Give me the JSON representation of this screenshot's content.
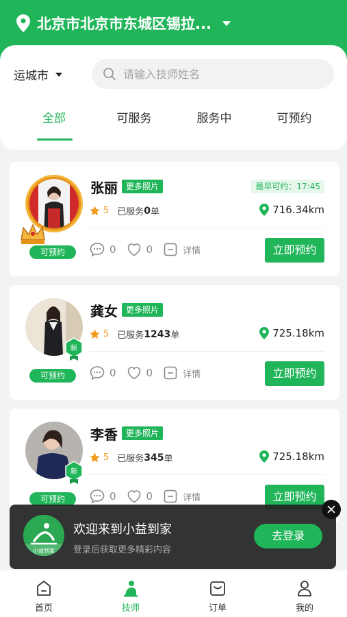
{
  "header": {
    "location": "北京市北京市东城区锡拉..."
  },
  "filter": {
    "city": "运城市",
    "search_placeholder": "请输入技师姓名"
  },
  "tabs": [
    {
      "label": "全部",
      "active": true
    },
    {
      "label": "可服务",
      "active": false
    },
    {
      "label": "服务中",
      "active": false
    },
    {
      "label": "可预约",
      "active": false
    }
  ],
  "technicians": [
    {
      "name": "张丽",
      "more_photos": "更多照片",
      "earliest": "最早可约：17:45",
      "rating": "5",
      "served_prefix": "已服务",
      "served_count": "0",
      "served_suffix": "单",
      "distance": "716.34km",
      "comments": "0",
      "likes": "0",
      "details": "详情",
      "book": "立即预约",
      "status": "可预约"
    },
    {
      "name": "龚女",
      "more_photos": "更多照片",
      "rating": "5",
      "served_prefix": "已服务",
      "served_count": "1243",
      "served_suffix": "单",
      "distance": "725.18km",
      "comments": "0",
      "likes": "0",
      "details": "详情",
      "book": "立即预约",
      "status": "可预约",
      "badge": "新"
    },
    {
      "name": "李香",
      "more_photos": "更多照片",
      "rating": "5",
      "served_prefix": "已服务",
      "served_count": "345",
      "served_suffix": "单",
      "distance": "725.18km",
      "comments": "0",
      "likes": "0",
      "details": "详情",
      "book": "立即预约",
      "status": "可预约",
      "badge": "新"
    }
  ],
  "login_banner": {
    "title": "欢迎来到小益到家",
    "subtitle": "登录后获取更多精彩内容",
    "button": "去登录",
    "logo_text": "小益到家"
  },
  "bottom_nav": [
    {
      "label": "首页",
      "icon": "home-icon",
      "active": false
    },
    {
      "label": "技师",
      "icon": "technician-icon",
      "active": true
    },
    {
      "label": "订单",
      "icon": "order-icon",
      "active": false
    },
    {
      "label": "我的",
      "icon": "profile-icon",
      "active": false
    }
  ],
  "colors": {
    "brand_green": "#21b55a",
    "rating_orange": "#f39a1c"
  }
}
